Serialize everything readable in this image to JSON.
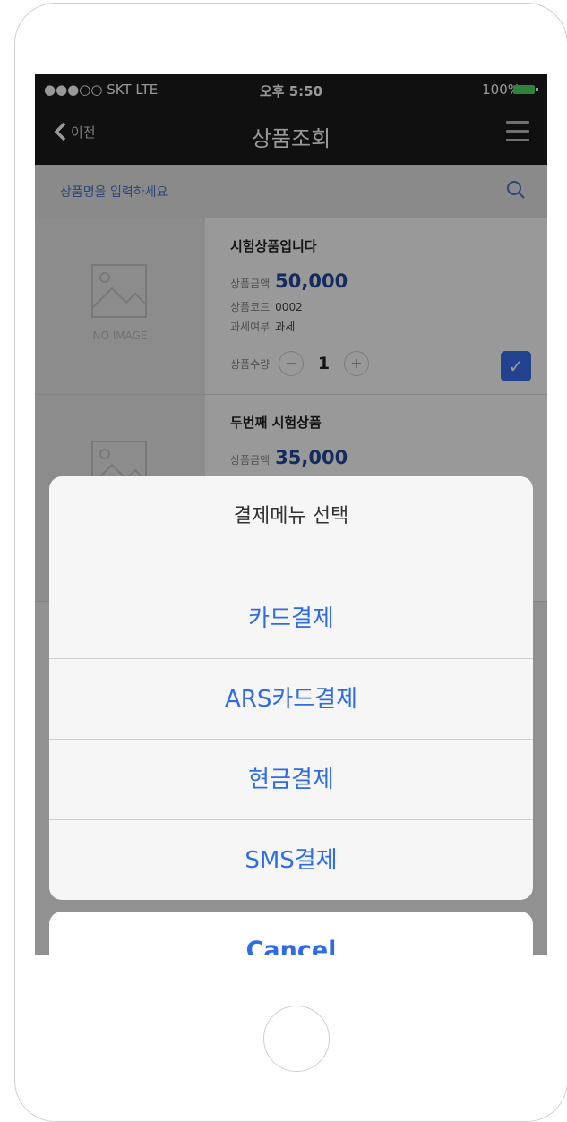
{
  "status": {
    "carrier": "●●●○○ SKT  LTE",
    "time": "오후 5:50",
    "battery": "100%"
  },
  "nav": {
    "back_label": "이전",
    "title": "상품조회"
  },
  "search": {
    "placeholder": "상품명을 입력하세요"
  },
  "products": [
    {
      "name": "시험상품입니다",
      "price_label": "상품금액",
      "price": "50,000",
      "code_label": "상품코드",
      "code": "0002",
      "tax_label": "과세여부",
      "tax": "과세",
      "qty_label": "상품수량",
      "qty": "1",
      "noimage": "NO IMAGE"
    },
    {
      "name": "두번째 시험상품",
      "price_label": "상품금액",
      "price": "35,000"
    }
  ],
  "sheet": {
    "title": "결제메뉴 선택",
    "options": [
      "카드결제",
      "ARS카드결제",
      "현금결제",
      "SMS결제"
    ],
    "cancel": "Cancel"
  },
  "colors": {
    "accent": "#2f6be6",
    "price": "#23479d",
    "bar": "#1b1b1b"
  }
}
